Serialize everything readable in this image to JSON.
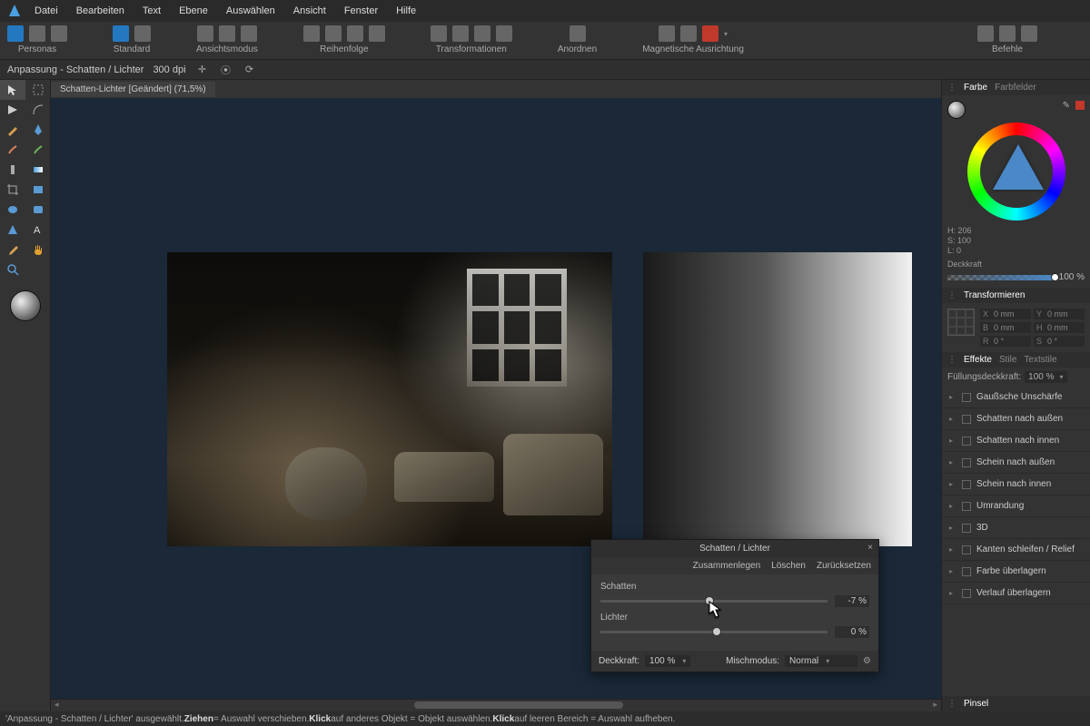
{
  "menu": {
    "items": [
      "Datei",
      "Bearbeiten",
      "Text",
      "Ebene",
      "Auswählen",
      "Ansicht",
      "Fenster",
      "Hilfe"
    ]
  },
  "toolbar": {
    "groups": [
      {
        "label": "Personas"
      },
      {
        "label": "Standard"
      },
      {
        "label": "Ansichtsmodus"
      },
      {
        "label": "Reihenfolge"
      },
      {
        "label": "Transformationen"
      },
      {
        "label": "Anordnen"
      },
      {
        "label": "Magnetische Ausrichtung"
      }
    ],
    "right": "Befehle"
  },
  "contextbar": {
    "title": "Anpassung - Schatten / Lichter",
    "dpi": "300 dpi"
  },
  "tab": {
    "title": "Schatten-Lichter [Geändert] (71,5%)"
  },
  "colorpanel": {
    "tabs": [
      "Farbe",
      "Farbfelder"
    ],
    "hsl": {
      "h": "H: 206",
      "s": "S: 100",
      "l": "L: 0"
    },
    "opLabel": "Deckkraft",
    "opValue": "100 %"
  },
  "transform": {
    "tab": "Transformieren",
    "fields": {
      "x": "0 mm",
      "y": "0 mm",
      "w": "0 mm",
      "h": "0 mm",
      "r": "0 °",
      "s": "0 °"
    }
  },
  "effects": {
    "tabs": [
      "Effekte",
      "Stile",
      "Textstile"
    ],
    "fillLabel": "Füllungsdeckkraft:",
    "fillValue": "100 %",
    "items": [
      "Gaußsche Unschärfe",
      "Schatten nach außen",
      "Schatten nach innen",
      "Schein nach außen",
      "Schein nach innen",
      "Umrandung",
      "3D",
      "Kanten schleifen / Relief",
      "Farbe überlagern",
      "Verlauf überlagern"
    ]
  },
  "bottompanel": {
    "tab": "Pinsel"
  },
  "dialog": {
    "title": "Schatten / Lichter",
    "merge": "Zusammenlegen",
    "delete": "Löschen",
    "reset": "Zurücksetzen",
    "shadowsLabel": "Schatten",
    "shadowsValue": "-7 %",
    "highlightsLabel": "Lichter",
    "highlightsValue": "0 %",
    "opacityLabel": "Deckkraft:",
    "opacityValue": "100 %",
    "blendLabel": "Mischmodus:",
    "blendValue": "Normal"
  },
  "status": {
    "t1": "'Anpassung - Schatten / Lichter' ausgewählt. ",
    "b1": "Ziehen",
    "t2": " = Auswahl verschieben. ",
    "b2": "Klick",
    "t3": " auf anderes Objekt = Objekt auswählen. ",
    "b3": "Klick",
    "t4": " auf leeren Bereich = Auswahl aufheben."
  }
}
